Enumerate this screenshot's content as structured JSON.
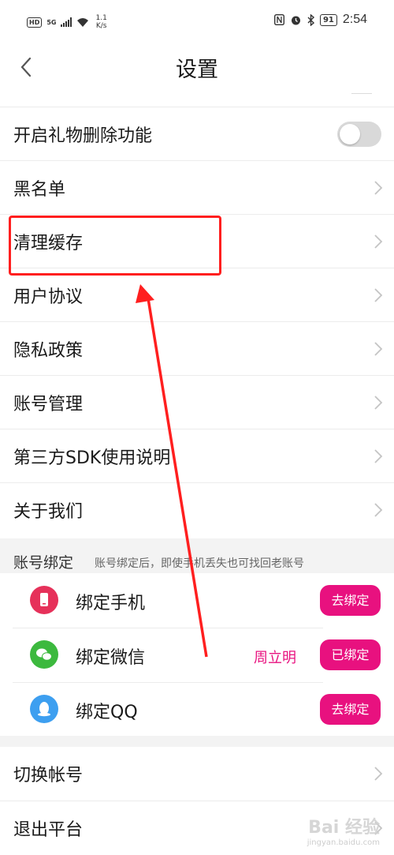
{
  "status_bar": {
    "hd": "HD",
    "signal": "5G",
    "speed_value": "1.1",
    "speed_unit": "K/s",
    "battery": "91",
    "time": "2:54"
  },
  "header": {
    "title": "设置"
  },
  "settings": {
    "gift_delete": "开启礼物删除功能",
    "blacklist": "黑名单",
    "clear_cache": "清理缓存",
    "user_agreement": "用户协议",
    "privacy_policy": "隐私政策",
    "account_management": "账号管理",
    "third_party_sdk": "第三方SDK使用说明",
    "about_us": "关于我们"
  },
  "toggle": {
    "gift_delete_on": false
  },
  "account_binding": {
    "title": "账号绑定",
    "subtitle": "账号绑定后，即使手机丢失也可找回老账号",
    "items": [
      {
        "label": "绑定手机",
        "button": "去绑定",
        "name": ""
      },
      {
        "label": "绑定微信",
        "button": "已绑定",
        "name": "周立明"
      },
      {
        "label": "绑定QQ",
        "button": "去绑定",
        "name": ""
      }
    ]
  },
  "bottom": {
    "switch_account": "切换帐号",
    "exit_platform": "退出平台"
  },
  "watermark": {
    "brand": "Bai 经验",
    "url": "jingyan.baidu.com"
  },
  "colors": {
    "accent": "#e8117f",
    "annotation": "#ff1f1f",
    "phone_icon": "#e6315a",
    "wechat_icon": "#3cb93e",
    "qq_icon": "#3d9ff0"
  }
}
